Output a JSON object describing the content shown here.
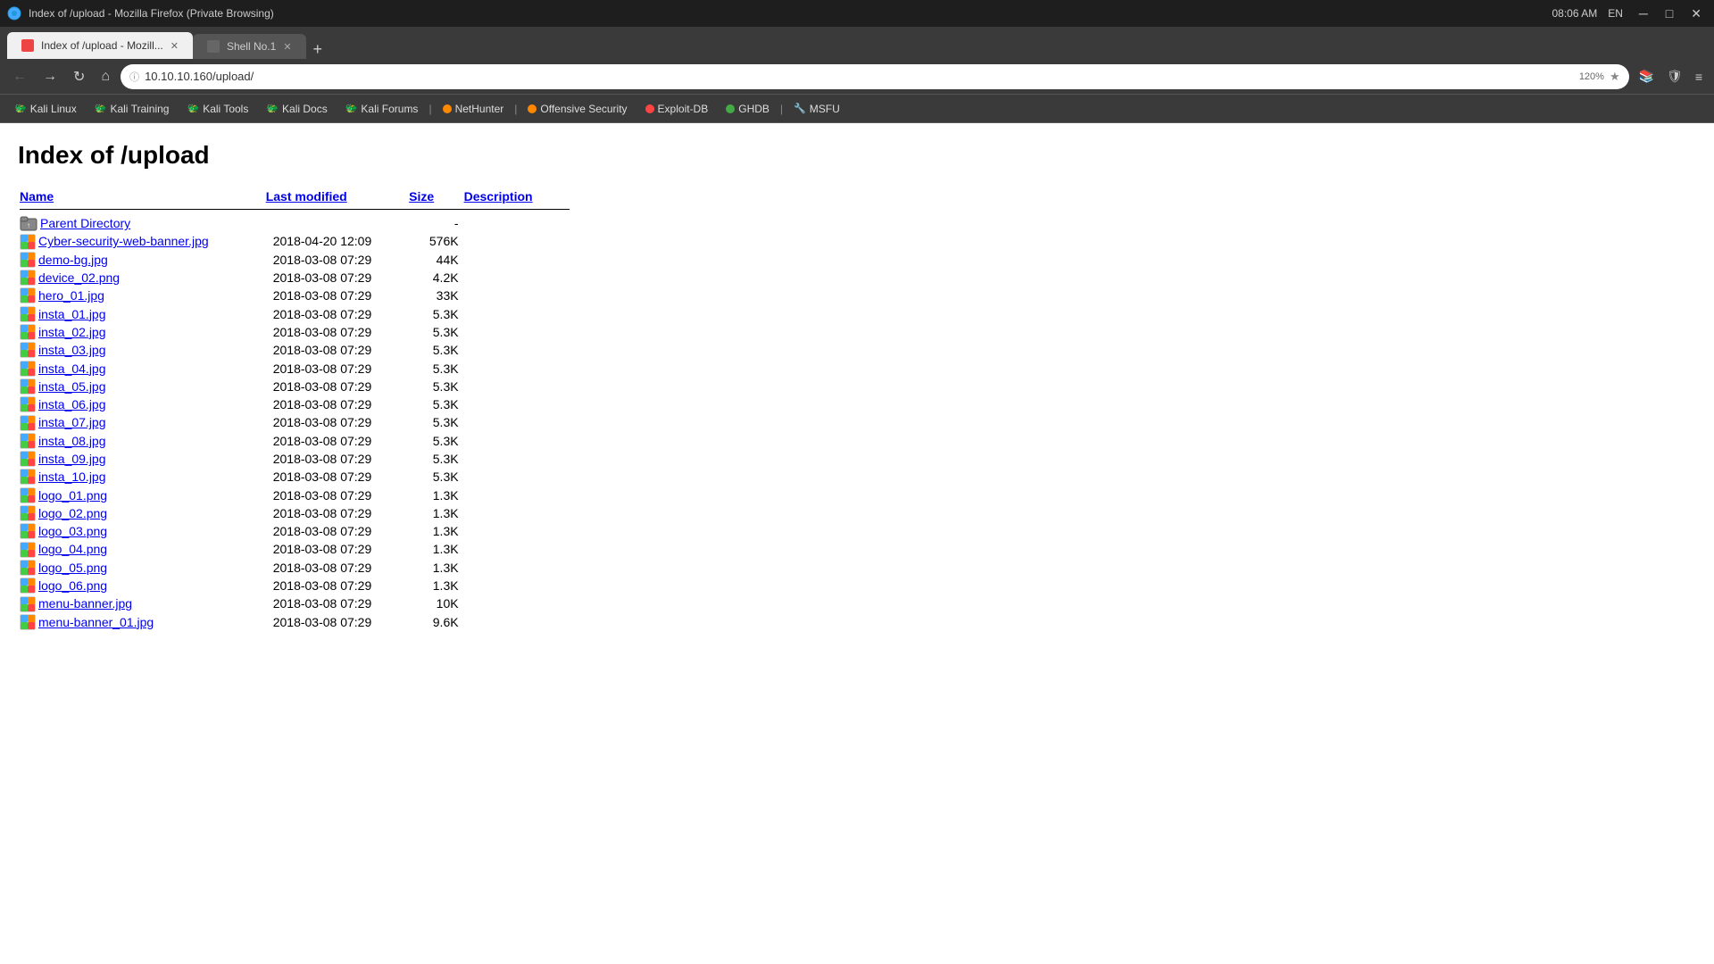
{
  "browser": {
    "title": "Index of /upload - Mozill...",
    "tab_active_label": "Index of /upload - Mozill...",
    "tab_inactive_label": "Shell No.1",
    "add_tab_label": "+",
    "private_browsing": "Mozilla Firefox (Private Browsing)",
    "title_full": "Index of /upload - Mozilla Firefox (Private Browsing)"
  },
  "nav": {
    "address": "10.10.10.160/upload/",
    "zoom": "120%"
  },
  "bookmarks": [
    {
      "id": "kali-linux",
      "label": "Kali Linux",
      "dot_color": null
    },
    {
      "id": "kali-training",
      "label": "Kali Training",
      "dot_color": null
    },
    {
      "id": "kali-tools",
      "label": "Kali Tools",
      "dot_color": null
    },
    {
      "id": "kali-docs",
      "label": "Kali Docs",
      "dot_color": null
    },
    {
      "id": "kali-forums",
      "label": "Kali Forums",
      "dot_color": null
    },
    {
      "id": "nethunter",
      "label": "NetHunter",
      "dot_color": "orange"
    },
    {
      "id": "offensive-security",
      "label": "Offensive Security",
      "dot_color": "orange"
    },
    {
      "id": "exploit-db",
      "label": "Exploit-DB",
      "dot_color": "red"
    },
    {
      "id": "ghdb",
      "label": "GHDB",
      "dot_color": "green"
    },
    {
      "id": "msfu",
      "label": "MSFU",
      "dot_color": null
    }
  ],
  "page": {
    "title": "Index of /upload",
    "columns": {
      "name": "Name",
      "last_modified": "Last modified",
      "size": "Size",
      "description": "Description"
    },
    "files": [
      {
        "name": "Parent Directory",
        "date": "",
        "size": "-",
        "type": "parent"
      },
      {
        "name": "Cyber-security-web-banner.jpg",
        "date": "2018-04-20 12:09",
        "size": "576K",
        "type": "image"
      },
      {
        "name": "demo-bg.jpg",
        "date": "2018-03-08 07:29",
        "size": "44K",
        "type": "image"
      },
      {
        "name": "device_02.png",
        "date": "2018-03-08 07:29",
        "size": "4.2K",
        "type": "image"
      },
      {
        "name": "hero_01.jpg",
        "date": "2018-03-08 07:29",
        "size": "33K",
        "type": "image"
      },
      {
        "name": "insta_01.jpg",
        "date": "2018-03-08 07:29",
        "size": "5.3K",
        "type": "image"
      },
      {
        "name": "insta_02.jpg",
        "date": "2018-03-08 07:29",
        "size": "5.3K",
        "type": "image"
      },
      {
        "name": "insta_03.jpg",
        "date": "2018-03-08 07:29",
        "size": "5.3K",
        "type": "image"
      },
      {
        "name": "insta_04.jpg",
        "date": "2018-03-08 07:29",
        "size": "5.3K",
        "type": "image"
      },
      {
        "name": "insta_05.jpg",
        "date": "2018-03-08 07:29",
        "size": "5.3K",
        "type": "image"
      },
      {
        "name": "insta_06.jpg",
        "date": "2018-03-08 07:29",
        "size": "5.3K",
        "type": "image"
      },
      {
        "name": "insta_07.jpg",
        "date": "2018-03-08 07:29",
        "size": "5.3K",
        "type": "image"
      },
      {
        "name": "insta_08.jpg",
        "date": "2018-03-08 07:29",
        "size": "5.3K",
        "type": "image"
      },
      {
        "name": "insta_09.jpg",
        "date": "2018-03-08 07:29",
        "size": "5.3K",
        "type": "image"
      },
      {
        "name": "insta_10.jpg",
        "date": "2018-03-08 07:29",
        "size": "5.3K",
        "type": "image"
      },
      {
        "name": "logo_01.png",
        "date": "2018-03-08 07:29",
        "size": "1.3K",
        "type": "image"
      },
      {
        "name": "logo_02.png",
        "date": "2018-03-08 07:29",
        "size": "1.3K",
        "type": "image"
      },
      {
        "name": "logo_03.png",
        "date": "2018-03-08 07:29",
        "size": "1.3K",
        "type": "image"
      },
      {
        "name": "logo_04.png",
        "date": "2018-03-08 07:29",
        "size": "1.3K",
        "type": "image"
      },
      {
        "name": "logo_05.png",
        "date": "2018-03-08 07:29",
        "size": "1.3K",
        "type": "image"
      },
      {
        "name": "logo_06.png",
        "date": "2018-03-08 07:29",
        "size": "1.3K",
        "type": "image"
      },
      {
        "name": "menu-banner.jpg",
        "date": "2018-03-08 07:29",
        "size": "10K",
        "type": "image"
      },
      {
        "name": "menu-banner_01.jpg",
        "date": "2018-03-08 07:29",
        "size": "9.6K",
        "type": "image"
      }
    ]
  },
  "clock": "08:06 AM",
  "locale": "EN"
}
